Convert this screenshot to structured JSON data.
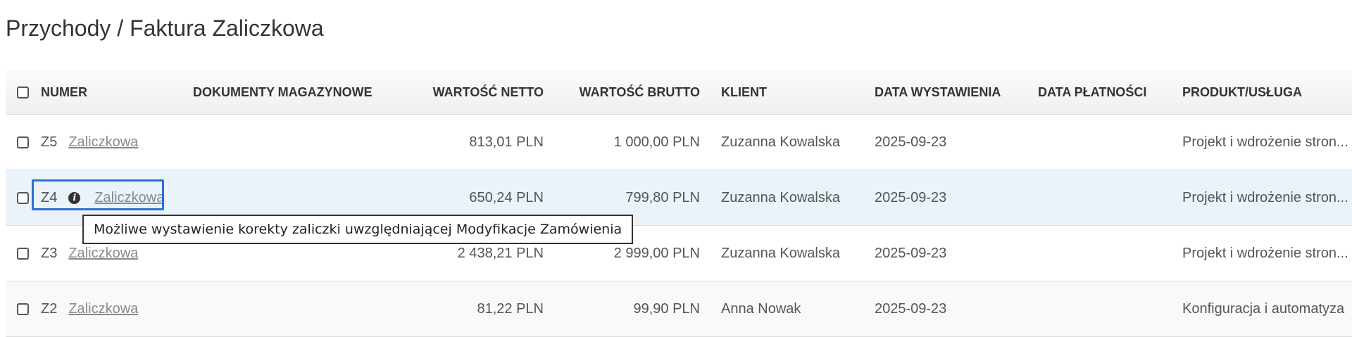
{
  "page": {
    "title": "Przychody / Faktura Zaliczkowa"
  },
  "table": {
    "columns": {
      "numer": "NUMER",
      "dokumenty": "DOKUMENTY MAGAZYNOWE",
      "netto": "WARTOŚĆ NETTO",
      "brutto": "WARTOŚĆ BRUTTO",
      "klient": "KLIENT",
      "data_wystawienia": "DATA WYSTAWIENIA",
      "data_platnosci": "DATA PŁATNOŚCI",
      "produkt": "PRODUKT/USŁUGA"
    },
    "rows": [
      {
        "number": "Z5",
        "type": "Zaliczkowa",
        "documents": "",
        "net": "813,01 PLN",
        "gross": "1 000,00 PLN",
        "client": "Zuzanna Kowalska",
        "issue_date": "2025-09-23",
        "payment_date": "",
        "product": "Projekt i wdrożenie stron..."
      },
      {
        "number": "Z4",
        "type": "Zaliczkowa",
        "documents": "",
        "net": "650,24 PLN",
        "gross": "799,80 PLN",
        "client": "Zuzanna Kowalska",
        "issue_date": "2025-09-23",
        "payment_date": "",
        "product": "Projekt i wdrożenie stron..."
      },
      {
        "number": "Z3",
        "type": "Zaliczkowa",
        "documents": "",
        "net": "2 438,21 PLN",
        "gross": "2 999,00 PLN",
        "client": "Zuzanna Kowalska",
        "issue_date": "2025-09-23",
        "payment_date": "",
        "product": "Projekt i wdrożenie stron..."
      },
      {
        "number": "Z2",
        "type": "Zaliczkowa",
        "documents": "",
        "net": "81,22 PLN",
        "gross": "99,90 PLN",
        "client": "Anna Nowak",
        "issue_date": "2025-09-23",
        "payment_date": "",
        "product": "Konfiguracja i automatyza"
      }
    ]
  },
  "tooltip": {
    "text": "Możliwe wystawienie korekty zaliczki uwzględniającej Modyfikacje Zamówienia"
  },
  "icons": {
    "info": "info-circle-icon"
  },
  "colors": {
    "focus_border": "#2b6fd6",
    "link": "#8a8a8a",
    "highlight_row": "#eaf2fa"
  }
}
